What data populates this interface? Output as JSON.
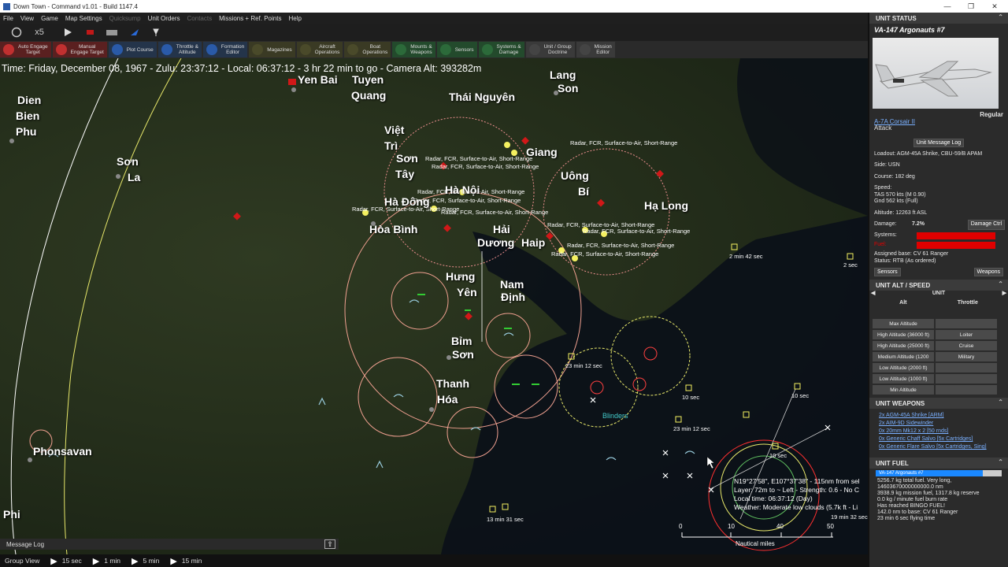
{
  "window": {
    "title": "Down Town - Command v1.01 - Build 1147.4",
    "min": "—",
    "restore": "❐",
    "close": "✕"
  },
  "menu": [
    "File",
    "View",
    "Game",
    "Map Settings",
    "Quicksump",
    "Unit Orders",
    "Contacts",
    "Missions + Ref. Points",
    "Help"
  ],
  "toolbar1": {
    "speed": "x5"
  },
  "toolbar2": [
    {
      "l1": "Auto Engage",
      "l2": "Target",
      "color": "#c03030"
    },
    {
      "l1": "Manual",
      "l2": "Engage Target",
      "color": "#c03030"
    },
    {
      "l1": "Plot Course",
      "l2": "",
      "color": "#2a5aa8"
    },
    {
      "l1": "Throttle &",
      "l2": "Altitude",
      "color": "#2a5aa8"
    },
    {
      "l1": "Formation",
      "l2": "Editor",
      "color": "#2a5aa8"
    },
    {
      "l1": "Magazines",
      "l2": "",
      "color": "#4a4a2a"
    },
    {
      "l1": "Aircraft",
      "l2": "Operations",
      "color": "#4a4a2a"
    },
    {
      "l1": "Boat",
      "l2": "Operations",
      "color": "#4a4a2a"
    },
    {
      "l1": "Mounts &",
      "l2": "Weapons",
      "color": "#2c6a3a"
    },
    {
      "l1": "Sensors",
      "l2": "",
      "color": "#2c6a3a"
    },
    {
      "l1": "Systems &",
      "l2": "Damage",
      "color": "#2c6a3a"
    },
    {
      "l1": "Unit / Group",
      "l2": "Doctrine",
      "color": "#444"
    },
    {
      "l1": "Mission",
      "l2": "Editor",
      "color": "#444"
    }
  ],
  "map": {
    "time_info": "Time: Friday, December 08, 1967 - Zulu: 23:37:12 - Local: 06:37:12 - 3 hr 22 min to go -  Camera Alt: 393282m",
    "cities": [
      {
        "name": "Yen Bai",
        "cls": "c1"
      },
      {
        "name": "Tuyen",
        "cls": "c2"
      },
      {
        "name": "Quang",
        "cls": "c3"
      },
      {
        "name": "Lang",
        "cls": "c4"
      },
      {
        "name": "Son",
        "cls": "c5"
      },
      {
        "name": "Dien",
        "cls": "c6"
      },
      {
        "name": "Bien",
        "cls": "c7"
      },
      {
        "name": "Phu",
        "cls": "c8"
      },
      {
        "name": "Thái Nguyên",
        "cls": "c9"
      },
      {
        "name": "Việt",
        "cls": "c10"
      },
      {
        "name": "Trì",
        "cls": "c11"
      },
      {
        "name": "Sơn",
        "cls": "c12"
      },
      {
        "name": "Tây",
        "cls": "c13"
      },
      {
        "name": "Giang",
        "cls": "c14"
      },
      {
        "name": "Uông",
        "cls": "c15"
      },
      {
        "name": "Bí",
        "cls": "c16"
      },
      {
        "name": "Sơn",
        "cls": "c17"
      },
      {
        "name": "La",
        "cls": "c18"
      },
      {
        "name": "Hạ Long",
        "cls": "c19"
      },
      {
        "name": "Hà Đông",
        "cls": "c20"
      },
      {
        "name": "Hòa Bình",
        "cls": "c21"
      },
      {
        "name": "Hải",
        "cls": "c22"
      },
      {
        "name": "Dương",
        "cls": "c23"
      },
      {
        "name": "Haip",
        "cls": "c24"
      },
      {
        "name": "Hưng",
        "cls": "c25"
      },
      {
        "name": "Yên",
        "cls": "c26"
      },
      {
        "name": "Nam",
        "cls": "c27"
      },
      {
        "name": "Định",
        "cls": "c28"
      },
      {
        "name": "Bỉm",
        "cls": "c29"
      },
      {
        "name": "Sơn",
        "cls": "c30"
      },
      {
        "name": "Thanh",
        "cls": "c31"
      },
      {
        "name": "Hóa",
        "cls": "c32"
      },
      {
        "name": "Phonsavan",
        "cls": "c33"
      },
      {
        "name": "Hà Nội",
        "cls": "c34"
      },
      {
        "name": "Phi",
        "cls": "c35"
      }
    ],
    "sam_label": "Radar, FCR, Surface-to-Air, Short-Range",
    "timers": [
      "2 min 42 sec",
      "23 min 12 sec",
      "10 sec",
      "23 min 12 sec",
      "10 sec",
      "13 min 31 sec",
      "19 min 32 sec",
      "10 sec",
      "2 sec"
    ],
    "cursor_info": {
      "l1": "N19°27'58\", E107°37'38\" - 115nm from sel",
      "l2": "Layer: 72m to ~ Left - Strength: 0.6 - No C",
      "l3": "Local time: 06:37:12 (Day)",
      "l4": "Weather: Moderate low clouds (5.7k ft - Li"
    },
    "scale": {
      "t0": "0",
      "t1": "10",
      "t2": "40",
      "t3": "50",
      "units": "Nautical miles"
    },
    "bo_bloc": "Blinders"
  },
  "message_log": {
    "label": "Message Log",
    "expand": "⇧"
  },
  "status": {
    "group_view": "Group View",
    "t15s": "15 sec",
    "t1m": "1 min",
    "t5m": "5 min",
    "t15m": "15 min"
  },
  "unit_status": {
    "header": "UNIT STATUS",
    "name": "VA-147 Argonauts #7",
    "proficiency": "Regular",
    "type_link": "A-7A Corsair II",
    "role": "Attack",
    "msg_log_btn": "Unit Message Log",
    "loadout": "Loadout: AGM-45A Shrike, CBU-59/B APAM",
    "side": "Side: USN",
    "course": "Course: 182 deg",
    "speed_label": "Speed:",
    "tas": "TAS 570 kts (M 0.90)",
    "gnd": "Gnd 562 kts (Full)",
    "altitude": "Altitude: 12263 ft ASL",
    "damage_label": "Damage:",
    "damage_value": "7.2%",
    "damage_ctrl": "Damage Ctrl",
    "systems": "Systems:",
    "fuel": "Fuel:",
    "base": "Assigned base: CV 61 Ranger",
    "status": "Status: RTB (As ordered)",
    "sensors_btn": "Sensors",
    "weapons_btn": "Weapons"
  },
  "alt_speed": {
    "header": "UNIT ALT / SPEED",
    "unit": "UNIT",
    "alt_col": "Alt",
    "thr_col": "Throttle",
    "rows": [
      {
        "a": "Max Altitude",
        "b": ""
      },
      {
        "a": "High Altitude (36000 ft)",
        "b": "Loiter"
      },
      {
        "a": "High Altitude (25000 ft)",
        "b": "Cruise"
      },
      {
        "a": "Medium Altitude (1200",
        "b": "Military"
      },
      {
        "a": "Low Altitude (2000 ft)",
        "b": ""
      },
      {
        "a": "Low Altitude (1000 ft)",
        "b": ""
      },
      {
        "a": "Min Altitude",
        "b": ""
      }
    ]
  },
  "weapons": {
    "header": "UNIT WEAPONS",
    "items": [
      "2x AGM-45A Shrike [ARM]",
      "2x AIM-9D Sidewinder",
      "0x 20mm Mk12 x 2 [50 rnds]",
      "0x Generic Chaff Salvo [5x Cartridges]",
      "0x Generic Flare Salvo [5x Cartridges, Sing]"
    ]
  },
  "fuel": {
    "header": "UNIT FUEL",
    "bar_label": "VA-147 Argonauts #7",
    "bar_fraction": 0.85,
    "lines": [
      "5256.7 kg total fuel. Very long,",
      "14603670000000000.0 nm",
      "3938.9 kg mission fuel, 1317.8 kg reserve",
      "0.0 kg / minute fuel burn rate",
      "Has reached BINGO FUEL!",
      "142.0 nm to base: CV 61 Ranger",
      "23 min 6 sec flying time"
    ]
  }
}
